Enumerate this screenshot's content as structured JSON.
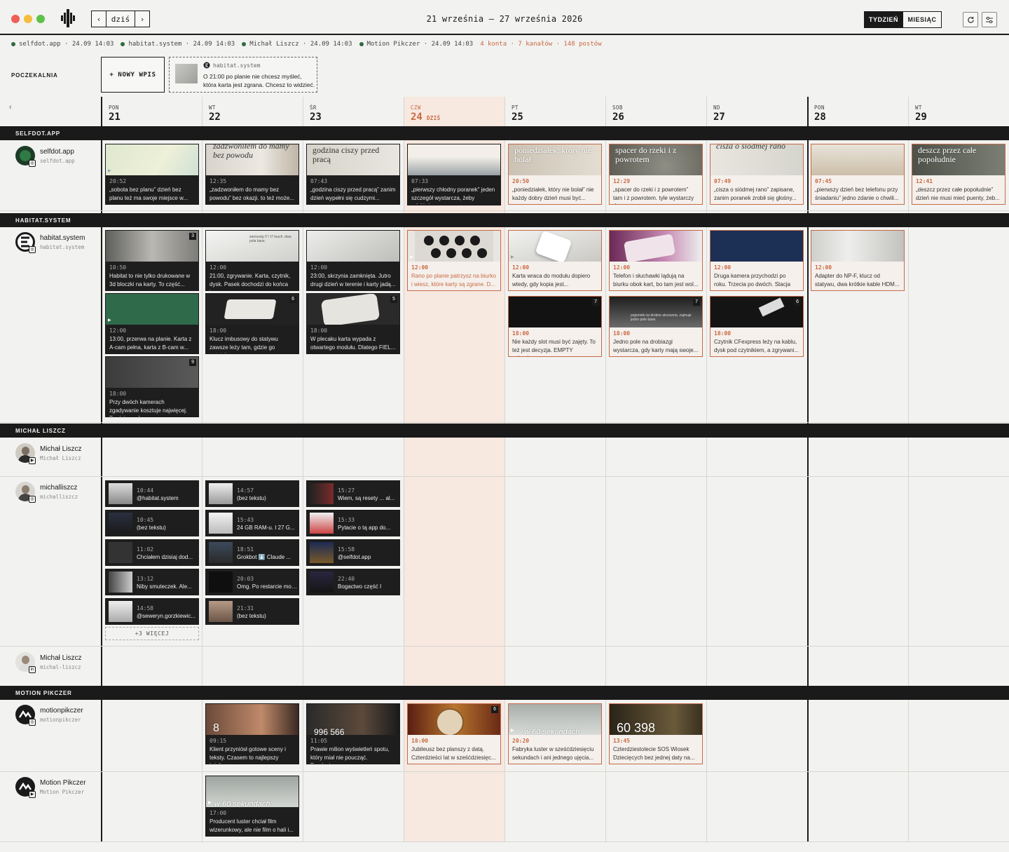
{
  "window": {
    "date_range": "21 września – 27 września 2026",
    "today_btn": "dziś",
    "prev_btn": "‹",
    "next_btn": "›",
    "view_week": "TYDZIEŃ",
    "view_month": "MIESIĄC",
    "refresh_icon": "refresh-icon",
    "settings_icon": "sliders-icon"
  },
  "status": {
    "items": [
      {
        "label": "selfdot.app · 24.09 14:03"
      },
      {
        "label": "habitat.system · 24.09 14:03"
      },
      {
        "label": "Michał Liszcz · 24.09 14:03"
      },
      {
        "label": "Motion Pikczer · 24.09 14:03"
      }
    ],
    "summary": "4 konta · 7 kanałów · 148 postów"
  },
  "waiting": {
    "label": "POCZEKALNIA",
    "new_post": "+ NOWY WPIS",
    "draft": {
      "account": "habitat.system",
      "text": "O 21:00 po planie nie chcesz myśleć, która karta jest zgrana. Chcesz to widzieć. Kart..."
    }
  },
  "days": [
    {
      "dn": "PON",
      "dd": "21"
    },
    {
      "dn": "WT",
      "dd": "22"
    },
    {
      "dn": "ŚR",
      "dd": "23"
    },
    {
      "dn": "CZW",
      "dd": "24",
      "today": "DZIŚ"
    },
    {
      "dn": "PT",
      "dd": "25"
    },
    {
      "dn": "SOB",
      "dd": "26"
    },
    {
      "dn": "ND",
      "dd": "27"
    },
    {
      "dn": "PON",
      "dd": "28"
    },
    {
      "dn": "WT",
      "dd": "29"
    }
  ],
  "sections": {
    "selfdot": "SELFDOT.APP",
    "habitat": "HABITAT.SYSTEM",
    "michal": "MICHAŁ LISZCZ",
    "motion": "MOTION PIKCZER"
  },
  "accounts": {
    "selfdot": {
      "name": "selfdot.app",
      "handle": "selfdot.app"
    },
    "habitat": {
      "name": "habitat.system",
      "handle": "habitat.system"
    },
    "michal1": {
      "name": "Michał Liszcz",
      "handle": "Michał Liszcz"
    },
    "michal2": {
      "name": "michalliszcz",
      "handle": "michalliszcz"
    },
    "michal3": {
      "name": "Michał Liszcz",
      "handle": "michal-liszcz"
    },
    "motion1": {
      "name": "motionpikczer",
      "handle": "motionpikczer"
    },
    "motion2": {
      "name": "Motion Pikczer",
      "handle": "Motion Pikczer"
    }
  },
  "selfdot_cards": [
    {
      "time": "20:52",
      "text": "„sobota bez planu” dzień bez planu też ma swoje miejsce w...",
      "img": ""
    },
    {
      "time": "12:35",
      "text": "„zadzwoniłem do mamy bez powodu” bez okazji. to też może...",
      "img": "zadzwoniłem do mamy bez powodu"
    },
    {
      "time": "07:43",
      "text": "„godzina ciszy przed pracą” zanim dzień wypełni się cudzymi...",
      "img": "godzina ciszy przed pracą"
    },
    {
      "time": "07:33",
      "text": "„pierwszy chłodny poranek” jeden szczegół wystarcza, żeby odróżni...",
      "img": ""
    },
    {
      "time": "20:50",
      "text": "„poniedziałek, który nie bolał” nie każdy dobry dzień musi być...",
      "img": "poniedziałek, który nie bolał"
    },
    {
      "time": "12:29",
      "text": "„spacer do rzeki i z powrotem” tam i z powrotem. tyle wystarczy do...",
      "img": "spacer do rzeki i z powrotem"
    },
    {
      "time": "07:49",
      "text": "„cisza o siódmej rano” zapisane, zanim poranek zrobił się głośny...",
      "img": "cisza o siódmej rano"
    },
    {
      "time": "07:45",
      "text": "„pierwszy dzień bez telefonu przy śniadaniu” jedno zdanie o chwili...",
      "img": ""
    },
    {
      "time": "12:41",
      "text": "„deszcz przez całe popołudnie” dzień nie musi mieć puenty, żeb...",
      "img": "deszcz przez całe popołudnie"
    }
  ],
  "habitat_cards": [
    {
      "time": "10:50",
      "text": "Habitat to nie tylko drukowane w 3d bloczki na karty. To część...",
      "count": "3"
    },
    {
      "time": "12:00",
      "text": "13:00, przerwa na planie. Karta z A-cam pełna, karta z B-cam w..."
    },
    {
      "time": "18:00",
      "text": "Przy dwóch kamerach zgadywanie kosztuje najwięcej. Po dniu na A...",
      "count": "9"
    },
    {
      "time": "12:00",
      "text": "21:00, zgrywanie. Karta, czytnik, dysk. Pasek dochodzi do końca i...",
      "img": "samsung t7 i t7 touch. dwa pola base."
    },
    {
      "time": "18:00",
      "text": "Klucz imbusowy do statywu zawsze leży tam, gdzie go ostatnio...",
      "count": "6"
    },
    {
      "time": "12:00",
      "text": "23:00, skrzynia zamknięta. Jutro drugi dzień w terenie i karty jadą..."
    },
    {
      "time": "18:00",
      "text": "W plecaku karta wypada z otwartego modułu. Dlatego FIEL...",
      "count": "5"
    },
    {
      "time": "12:00",
      "text": "Rano po planie patrzysz na biurko i wiesz, które karty są zgrane. D..."
    },
    {
      "time": "12:00",
      "text": "Karta wraca do modułu dopiero wtedy, gdy kopia jest..."
    },
    {
      "time": "18:00",
      "text": "Nie każdy slot musi być zajęty. To też jest decyzja. EMPTY zajmuje...",
      "count": "7"
    },
    {
      "time": "12:00",
      "text": "Telefon i słuchawki lądują na biurku obok kart, bo tam jest wol..."
    },
    {
      "time": "18:00",
      "text": "Jedno pole na drobiazgi wystarcza, gdy karty mają swoje...",
      "count": "7",
      "img": "pojemnik na drobne akcesoria. zajmuje jedno pole base."
    },
    {
      "time": "12:00",
      "text": "Druga kamera przychodzi po roku. Trzecia po dwóch. Stacja na..."
    },
    {
      "time": "18:00",
      "text": "Czytnik CFexpress leży na kablu, dysk pod czytnikiem, a zgrywani...",
      "count": "6"
    },
    {
      "time": "12:00",
      "text": "Adapter do NP-F, klucz od statywu, dwa krótkie kable HDM..."
    }
  ],
  "michal_cards": [
    {
      "time": "10:44",
      "text": "@habitat.system"
    },
    {
      "time": "10:45",
      "text": "(bez tekstu)"
    },
    {
      "time": "11:02",
      "text": "Chciałem dzisiaj dod..."
    },
    {
      "time": "13:12",
      "text": "Niby smuteczek. Ale..."
    },
    {
      "time": "14:58",
      "text": "@seweryn.gorzkiewic..."
    },
    {
      "time": "14:57",
      "text": "(bez tekstu)"
    },
    {
      "time": "15:43",
      "text": "24 GB RAM-u. I 27 G..."
    },
    {
      "time": "18:51",
      "text": "Grokbot ⬇️ Claude ..."
    },
    {
      "time": "20:03",
      "text": "Omg. Po restarcie moj..."
    },
    {
      "time": "21:31",
      "text": "(bez tekstu)"
    },
    {
      "time": "15:27",
      "text": "Wiem, są resety ... al..."
    },
    {
      "time": "15:33",
      "text": "Pytacie o tą app do..."
    },
    {
      "time": "15:58",
      "text": "@selfdot.app"
    },
    {
      "time": "22:40",
      "text": "Bogactwo część I"
    }
  ],
  "michal_more": "+3 WIĘCEJ",
  "motion_cards": [
    {
      "time": "09:15",
      "text": "Klient przyniósł gotowe sceny i teksty. Czasem to najlepszy brief,...",
      "img": "8"
    },
    {
      "time": "11:05",
      "text": "Prawie milion wyświetleń spotu, który miał nie poucząć. Fundacja...",
      "img": "996 566"
    },
    {
      "time": "18:00",
      "text": "Jubileusz bez planszy z datą. Czterdzieści lat w sześćdziesięc...",
      "count": "6"
    },
    {
      "time": "20:20",
      "text": "Fabryka luster w sześćdziesięciu sekundach i ani jednego ujęcia...",
      "img": "w 60 sekundach"
    },
    {
      "time": "13:45",
      "text": "Czterdziestolecie SOS Wiosek Dziecięcych bez jednej daty na...",
      "img": "60 398"
    },
    {
      "time": "17:00",
      "text": "Producent luster chciał film wizerunkowy, ale nie film o hali i...",
      "img": "w 60 sekundach"
    }
  ],
  "colors": {
    "accent": "#c96a42",
    "dark": "#1a1a1a",
    "today_bg": "#f7e8e0",
    "status_dot": "#2e6b3f"
  }
}
